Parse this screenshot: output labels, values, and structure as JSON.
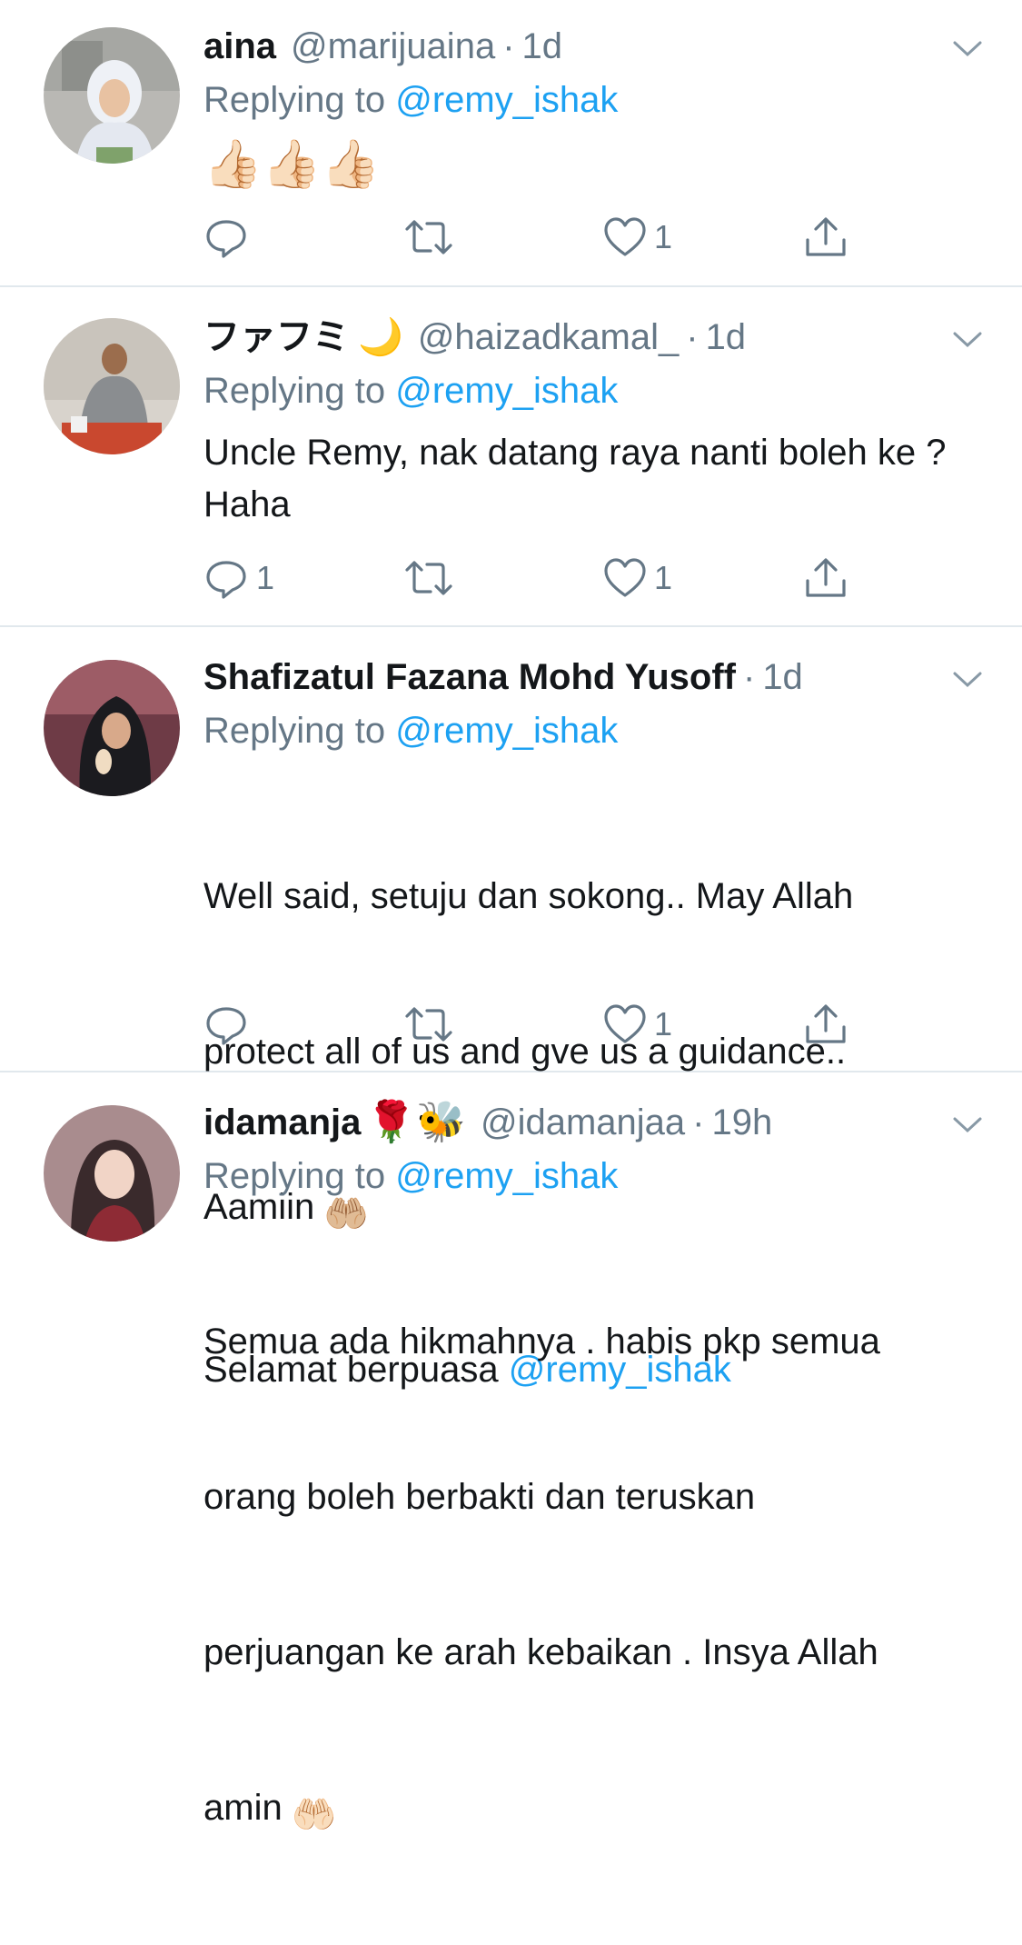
{
  "tweets": [
    {
      "name": "aina",
      "handle": "@marijuaina",
      "separator": "·",
      "time": "1d",
      "replying_prefix": "Replying to",
      "replying_to": "@remy_ishak",
      "text": "",
      "emoji_text": "👍🏻👍🏻👍🏻",
      "reply_count": "",
      "retweet_count": "",
      "like_count": "1"
    },
    {
      "name": "ファフミ",
      "name_emoji": "🌙",
      "handle": "@haizadkamal_",
      "separator": "·",
      "time": "1d",
      "replying_prefix": "Replying to",
      "replying_to": "@remy_ishak",
      "text": "Uncle Remy, nak datang raya nanti boleh ke ? Haha",
      "reply_count": "1",
      "retweet_count": "",
      "like_count": "1"
    },
    {
      "name": "Shafizatul Fazana Mohd Yusoff",
      "separator": "·",
      "time": "1d",
      "replying_prefix": "Replying to",
      "replying_to": "@remy_ishak",
      "text_line1": "Well said, setuju dan sokong.. May Allah",
      "text_line2": "protect all of us and gve us a guidance..",
      "text_line3": "Aamiin",
      "text_line3_emoji": "🤲🏼",
      "text_line4_prefix": "Selamat berpuasa",
      "text_line4_mention": "@remy_ishak",
      "reply_count": "",
      "retweet_count": "",
      "like_count": "1"
    },
    {
      "name": "idamanja",
      "name_emoji": "🌹🐝",
      "handle": "@idamanjaa",
      "separator": "·",
      "time": "19h",
      "replying_prefix": "Replying to",
      "replying_to": "@remy_ishak",
      "text_line1": "Semua ada hikmahnya . habis pkp semua",
      "text_line2": "orang boleh berbakti dan teruskan",
      "text_line3": "perjuangan ke arah kebaikan . Insya Allah",
      "text_line4": "amin",
      "text_line4_emoji": "🤲🏻"
    }
  ],
  "icons": {
    "reply": "reply-icon",
    "retweet": "retweet-icon",
    "like": "like-icon",
    "share": "share-icon",
    "more": "chevron-down-icon"
  },
  "colors": {
    "text": "#14171a",
    "secondary": "#657786",
    "link": "#1da1f2",
    "divider": "#e1e8ed"
  }
}
